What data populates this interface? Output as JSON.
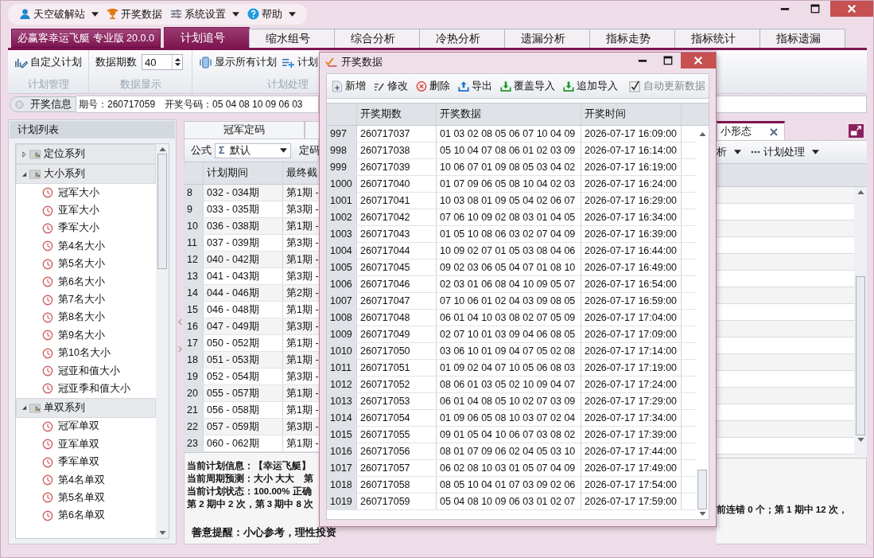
{
  "menu": [
    {
      "label": "天空破解站",
      "dropdown": true
    },
    {
      "label": "开奖数据",
      "dropdown": false
    },
    {
      "label": "系统设置",
      "dropdown": true
    },
    {
      "label": "帮助",
      "dropdown": true
    }
  ],
  "app_badge": "必赢客幸运飞艇 专业版 20.0.0",
  "tabs": [
    {
      "label": "计划追号",
      "selected": true
    },
    {
      "label": "缩水组号",
      "selected": false
    },
    {
      "label": "综合分析",
      "selected": false
    },
    {
      "label": "冷热分析",
      "selected": false
    },
    {
      "label": "遗漏分析",
      "selected": false
    },
    {
      "label": "指标走势",
      "selected": false
    },
    {
      "label": "指标统计",
      "selected": false
    },
    {
      "label": "指标遗漏",
      "selected": false
    }
  ],
  "ribbon": {
    "custom_plan": "自定义计划",
    "group_1": "计划管理",
    "period_label": "数据期数",
    "period_value": "40",
    "group_2": "数据显示",
    "show_all": "显示所有计划",
    "plan_button": "计划",
    "group_3": "计划处理"
  },
  "info_bar": {
    "button": "开奖信息",
    "issue": "期号：260717059",
    "numbers": "开奖号码：05 04 08 10 09 06 03"
  },
  "plan_list": {
    "title": "计划列表",
    "tree": [
      {
        "label": "定位系列",
        "expanded": false
      },
      {
        "label": "大小系列",
        "expanded": true,
        "children": [
          {
            "label": "冠军大小"
          },
          {
            "label": "亚军大小"
          },
          {
            "label": "季军大小"
          },
          {
            "label": "第4名大小"
          },
          {
            "label": "第5名大小"
          },
          {
            "label": "第6名大小"
          },
          {
            "label": "第7名大小"
          },
          {
            "label": "第8名大小"
          },
          {
            "label": "第9名大小"
          },
          {
            "label": "第10名大小"
          },
          {
            "label": "冠亚和值大小"
          },
          {
            "label": "冠亚季和值大小"
          }
        ]
      },
      {
        "label": "单双系列",
        "expanded": true,
        "children": [
          {
            "label": "冠军单双"
          },
          {
            "label": "亚军单双"
          },
          {
            "label": "季军单双"
          },
          {
            "label": "第4名单双"
          },
          {
            "label": "第5名单双"
          },
          {
            "label": "第6名单双"
          }
        ]
      }
    ]
  },
  "plan_tabs": [
    {
      "label": "冠军定码",
      "selected": false
    },
    {
      "label": "小形态",
      "selected": true
    }
  ],
  "plan_view": {
    "formula_label": "公式",
    "formula_symbol": "Σ",
    "formula_value": "默认",
    "code_label": "定码",
    "columns": [
      "计划期间",
      "最终截"
    ],
    "rows": [
      {
        "no": "8",
        "period": "032 - 034期",
        "result": "第1期 -"
      },
      {
        "no": "9",
        "period": "033 - 035期",
        "result": "第3期 -"
      },
      {
        "no": "10",
        "period": "036 - 038期",
        "result": "第1期 -"
      },
      {
        "no": "11",
        "period": "037 - 039期",
        "result": "第3期 -"
      },
      {
        "no": "12",
        "period": "040 - 042期",
        "result": "第1期 -"
      },
      {
        "no": "13",
        "period": "041 - 043期",
        "result": "第3期 -"
      },
      {
        "no": "14",
        "period": "044 - 046期",
        "result": "第2期 -"
      },
      {
        "no": "15",
        "period": "046 - 048期",
        "result": "第1期 -"
      },
      {
        "no": "16",
        "period": "047 - 049期",
        "result": "第3期 -"
      },
      {
        "no": "17",
        "period": "050 - 052期",
        "result": "第1期 -"
      },
      {
        "no": "18",
        "period": "051 - 053期",
        "result": "第1期 -"
      },
      {
        "no": "19",
        "period": "052 - 054期",
        "result": "第3期 -"
      },
      {
        "no": "20",
        "period": "055 - 057期",
        "result": "第1期 -"
      },
      {
        "no": "21",
        "period": "056 - 058期",
        "result": "第1期 -"
      },
      {
        "no": "22",
        "period": "057 - 059期",
        "result": "第3期 -"
      },
      {
        "no": "23",
        "period": "060 - 062期",
        "result": "第1期 -"
      }
    ],
    "info_lines": [
      "当前计划信息：【幸运飞艇】",
      "当前周期预测：大小 大大　第",
      "当前计划状态：100.00% 正确",
      "第 2 期中 2 次，第 3 期中 8 次"
    ],
    "warning": "善意提醒：小心参考，理性投资"
  },
  "right_panel": {
    "toolbar": [
      {
        "label": "析",
        "dropdown": true
      },
      {
        "label": "计划处理",
        "dropdown": true
      }
    ],
    "info": "前连错 0 个；第 1 期中 12 次，"
  },
  "dialog": {
    "title": "开奖数据",
    "toolbar": [
      {
        "label": "新增"
      },
      {
        "label": "修改"
      },
      {
        "label": "删除"
      },
      {
        "label": "导出"
      },
      {
        "label": "覆盖导入"
      },
      {
        "label": "追加导入"
      }
    ],
    "auto_update": {
      "label": "自动更新数据",
      "checked": true,
      "disabled": true
    },
    "columns": [
      "开奖期数",
      "开奖数据",
      "开奖时间"
    ],
    "rows": [
      {
        "no": "997",
        "issue": "260717037",
        "numbers": "01 03 02 08 05 06 07 10 04 09",
        "time": "2026-07-17 16:09:00"
      },
      {
        "no": "998",
        "issue": "260717038",
        "numbers": "05 10 04 07 08 06 01 02 03 09",
        "time": "2026-07-17 16:14:00"
      },
      {
        "no": "999",
        "issue": "260717039",
        "numbers": "10 06 07 01 09 08 05 03 04 02",
        "time": "2026-07-17 16:19:00"
      },
      {
        "no": "1000",
        "issue": "260717040",
        "numbers": "01 07 09 06 05 08 10 04 02 03",
        "time": "2026-07-17 16:24:00"
      },
      {
        "no": "1001",
        "issue": "260717041",
        "numbers": "10 03 08 01 09 05 04 02 06 07",
        "time": "2026-07-17 16:29:00"
      },
      {
        "no": "1002",
        "issue": "260717042",
        "numbers": "07 06 10 09 02 08 03 01 04 05",
        "time": "2026-07-17 16:34:00"
      },
      {
        "no": "1003",
        "issue": "260717043",
        "numbers": "01 05 10 08 06 03 02 07 04 09",
        "time": "2026-07-17 16:39:00"
      },
      {
        "no": "1004",
        "issue": "260717044",
        "numbers": "10 09 02 07 01 05 03 08 04 06",
        "time": "2026-07-17 16:44:00"
      },
      {
        "no": "1005",
        "issue": "260717045",
        "numbers": "09 02 03 06 05 04 07 01 08 10",
        "time": "2026-07-17 16:49:00"
      },
      {
        "no": "1006",
        "issue": "260717046",
        "numbers": "02 03 01 06 08 04 10 09 05 07",
        "time": "2026-07-17 16:54:00"
      },
      {
        "no": "1007",
        "issue": "260717047",
        "numbers": "07 10 06 01 02 04 03 09 08 05",
        "time": "2026-07-17 16:59:00"
      },
      {
        "no": "1008",
        "issue": "260717048",
        "numbers": "06 01 04 10 03 08 02 07 05 09",
        "time": "2026-07-17 17:04:00"
      },
      {
        "no": "1009",
        "issue": "260717049",
        "numbers": "02 07 10 01 03 09 04 06 08 05",
        "time": "2026-07-17 17:09:00"
      },
      {
        "no": "1010",
        "issue": "260717050",
        "numbers": "03 06 10 01 09 04 07 05 02 08",
        "time": "2026-07-17 17:14:00"
      },
      {
        "no": "1011",
        "issue": "260717051",
        "numbers": "01 09 02 04 07 10 05 06 08 03",
        "time": "2026-07-17 17:19:00"
      },
      {
        "no": "1012",
        "issue": "260717052",
        "numbers": "08 06 01 03 05 02 10 09 04 07",
        "time": "2026-07-17 17:24:00"
      },
      {
        "no": "1013",
        "issue": "260717053",
        "numbers": "06 01 04 08 05 10 02 07 03 09",
        "time": "2026-07-17 17:29:00"
      },
      {
        "no": "1014",
        "issue": "260717054",
        "numbers": "01 09 06 05 08 10 03 07 02 04",
        "time": "2026-07-17 17:34:00"
      },
      {
        "no": "1015",
        "issue": "260717055",
        "numbers": "09 01 05 04 10 06 07 03 08 02",
        "time": "2026-07-17 17:39:00"
      },
      {
        "no": "1016",
        "issue": "260717056",
        "numbers": "08 01 07 09 06 02 04 05 03 10",
        "time": "2026-07-17 17:44:00"
      },
      {
        "no": "1017",
        "issue": "260717057",
        "numbers": "06 02 08 10 03 01 05 07 04 09",
        "time": "2026-07-17 17:49:00"
      },
      {
        "no": "1018",
        "issue": "260717058",
        "numbers": "08 05 10 04 01 07 03 09 02 06",
        "time": "2026-07-17 17:54:00"
      },
      {
        "no": "1019",
        "issue": "260717059",
        "numbers": "05 04 08 10 09 06 03 01 02 07",
        "time": "2026-07-17 17:59:00"
      }
    ]
  }
}
